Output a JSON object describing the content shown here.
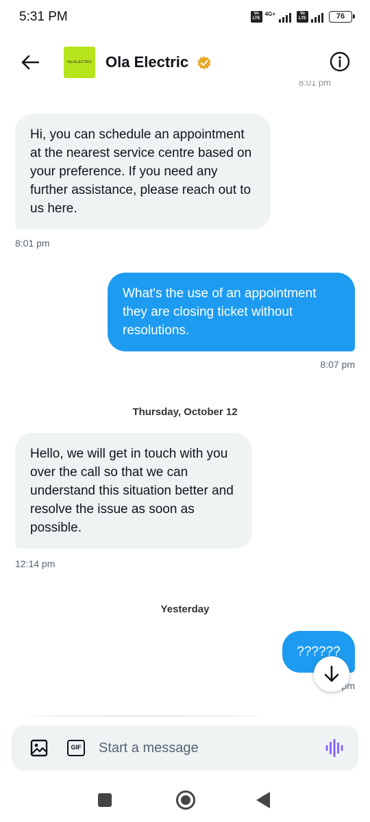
{
  "status_bar": {
    "time": "5:31 PM",
    "volte": "Vo LTE",
    "network": "4G+",
    "battery": "76"
  },
  "header": {
    "contact_name": "Ola Electric",
    "avatar_logo": "Ola ELECTRIC",
    "cut_off_time": "8:01 pm",
    "back_icon": "arrow-left-icon",
    "info_icon": "info-icon",
    "verified_icon": "verified-badge-icon"
  },
  "conversation": {
    "messages": [
      {
        "direction": "incoming",
        "text": "Hi, you can schedule an appointment at the nearest service centre based on your preference. If you need any further assistance, please reach out to us here.",
        "time": "8:01 pm"
      },
      {
        "direction": "outgoing",
        "text": "What's the use of an appointment they are closing ticket without resolutions.",
        "time": "8:07 pm"
      },
      {
        "direction": "incoming",
        "text": "Hello, we will get in touch with you over the call so that we can understand this situation better and resolve the issue as soon as possible.",
        "time": "12:14 pm"
      },
      {
        "direction": "outgoing",
        "text": "??????",
        "time": "pm"
      }
    ],
    "date_dividers": [
      "Thursday, October 12",
      "Yesterday"
    ]
  },
  "composer": {
    "gif_label": "GIF",
    "placeholder": "Start a message",
    "media_icon": "image-icon",
    "voice_icon": "voice-waveform-icon"
  },
  "colors": {
    "outgoing_bubble": "#1d9bf0",
    "incoming_bubble": "#eff3f4",
    "verified_gold": "#e8a92b",
    "voice_accent": "#7856ff",
    "avatar_bg": "#b7e51c"
  }
}
